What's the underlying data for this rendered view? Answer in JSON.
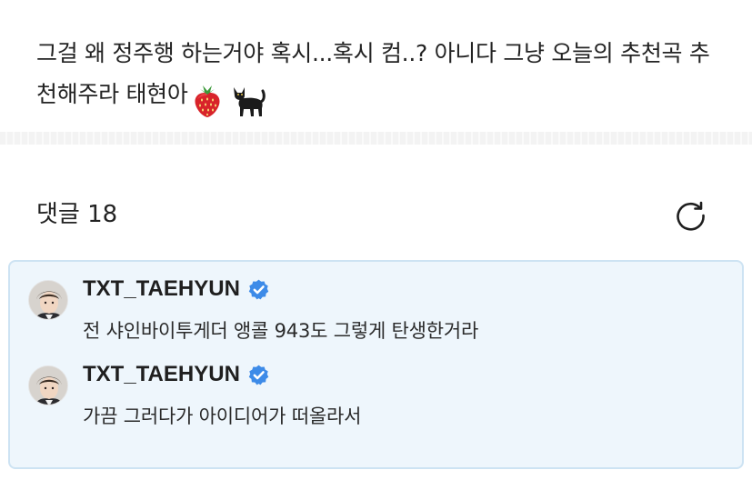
{
  "post": {
    "text": "그걸 왜 정주행 하는거야 혹시...혹시 컴..? 아니다 그냥 오늘의 추천곡 추천해주라 태현아",
    "emojis": [
      "strawberry-icon",
      "black-cat-icon"
    ]
  },
  "comments_section": {
    "title": "댓글 18",
    "refresh_icon": "refresh-icon"
  },
  "comments": [
    {
      "author": "TXT_TAEHYUN",
      "verified": true,
      "text": "전 샤인바이투게더 앵콜 943도 그렇게 탄생한거라"
    },
    {
      "author": "TXT_TAEHYUN",
      "verified": true,
      "text": "가끔 그러다가 아이디어가 떠올라서"
    }
  ],
  "colors": {
    "accent": "#3d8be8",
    "comments_bg": "#eef6fc",
    "comments_border": "#cde3f3"
  }
}
